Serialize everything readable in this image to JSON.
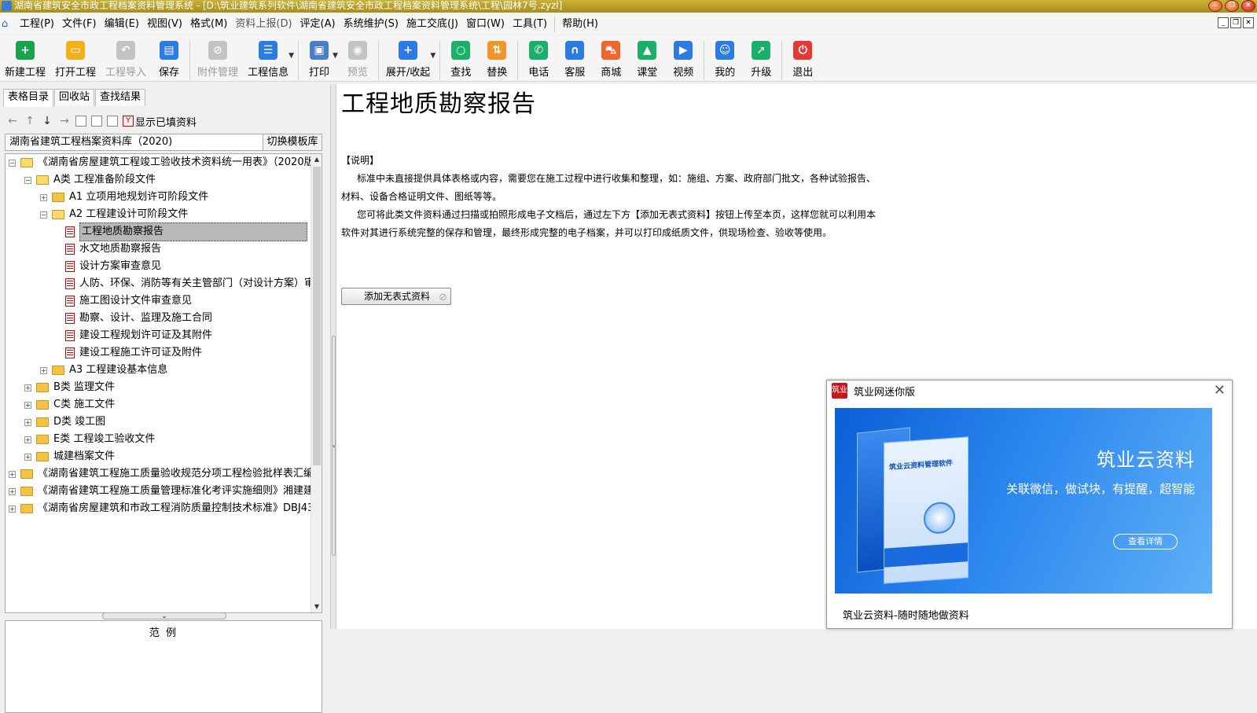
{
  "titlebar": {
    "title": "湖南省建筑安全市政工程档案资料管理系统 - [D:\\筑业建筑系列软件\\湖南省建筑安全市政工程档案资料管理系统\\工程\\园林7号.zyzl]"
  },
  "menu": [
    "工程(P)",
    "文件(F)",
    "编辑(E)",
    "视图(V)",
    "格式(M)",
    "资料上报(D)",
    "评定(A)",
    "系统维护(S)",
    "施工交底(J)",
    "窗口(W)",
    "工具(T)",
    "帮助(H)"
  ],
  "toolbar": [
    {
      "label": "新建工程",
      "icon": "new-project-icon",
      "color": "#1aa34a"
    },
    {
      "label": "打开工程",
      "icon": "open-folder-icon",
      "color": "#f2b11c"
    },
    {
      "label": "工程导入",
      "icon": "import-icon",
      "color": "#888888"
    },
    {
      "label": "保存",
      "icon": "save-icon",
      "color": "#2a7be4"
    },
    {
      "label": "附件管理",
      "icon": "attachment-icon",
      "color": "#888888"
    },
    {
      "label": "工程信息",
      "icon": "info-icon",
      "color": "#2a7be4"
    },
    {
      "label": "打印",
      "icon": "print-icon",
      "color": "#4a7ec8"
    },
    {
      "label": "预览",
      "icon": "preview-icon",
      "color": "#888888"
    },
    {
      "label": "展开/收起",
      "icon": "expand-icon",
      "color": "#2a7be4"
    },
    {
      "label": "查找",
      "icon": "search-icon",
      "color": "#1ab06a"
    },
    {
      "label": "替换",
      "icon": "replace-icon",
      "color": "#f0962a"
    },
    {
      "label": "电话",
      "icon": "phone-icon",
      "color": "#1ab06a"
    },
    {
      "label": "客服",
      "icon": "headset-icon",
      "color": "#2a7be4"
    },
    {
      "label": "商城",
      "icon": "cart-icon",
      "color": "#f0662a"
    },
    {
      "label": "课堂",
      "icon": "graduation-icon",
      "color": "#1ab06a"
    },
    {
      "label": "视频",
      "icon": "video-icon",
      "color": "#2a7be4"
    },
    {
      "label": "我的",
      "icon": "user-icon",
      "color": "#2a7be4"
    },
    {
      "label": "升级",
      "icon": "rocket-icon",
      "color": "#1ab06a"
    },
    {
      "label": "退出",
      "icon": "power-icon",
      "color": "#e53935"
    }
  ],
  "left": {
    "tabs": [
      "表格目录",
      "回收站",
      "查找结果"
    ],
    "show_filled": "显示已填资料",
    "library": "湖南省建筑工程档案资料库（2020)",
    "switch_template": "切换模板库",
    "tree": [
      "《湖南省房屋建筑工程竣工验收技术资料统一用表》（2020版",
      "A类 工程准备阶段文件",
      "A1 立项用地规划许可阶段文件",
      "A2 工程建设计可阶段文件",
      "工程地质勘察报告",
      "水文地质勘察报告",
      "设计方案审查意见",
      "人防、环保、消防等有关主管部门（对设计方案）审",
      "施工图设计文件审查意见",
      "勘察、设计、监理及施工合同",
      "建设工程规划许可证及其附件",
      "建设工程施工许可证及附件",
      "A3 工程建设基本信息",
      "B类 监理文件",
      "C类 施工文件",
      "D类 竣工图",
      "E类 工程竣工验收文件",
      "城建档案文件",
      "《湖南省建筑工程施工质量验收规范分项工程检验批样表汇编",
      "《湖南省建筑工程施工质量管理标准化考评实施细则》湘建建",
      "《湖南省房屋建筑和市政工程消防质量控制技术标准》DBJ43"
    ],
    "sample_title": "范 例"
  },
  "content": {
    "title": "工程地质勘察报告",
    "note_head": "【说明】",
    "p1": "标准中未直接提供具体表格或内容，需要您在施工过程中进行收集和整理，如：施组、方案、政府部门批文，各种试验报告、材料、设备合格证明文件、图纸等等。",
    "p2": "您可将此类文件资料通过扫描或拍照形成电子文档后，通过左下方【添加无表式资料】按钮上传至本页，这样您就可以利用本软件对其进行系统完整的保存和管理，最终形成完整的电子档案，并可以打印成纸质文件，供现场检查、验收等使用。",
    "add_button": "添加无表式资料"
  },
  "popup": {
    "logo": "筑业",
    "title": "筑业网迷你版",
    "banner_title": "筑业云资料",
    "banner_sub": "关联微信，做试块，有提醒，超智能",
    "banner_btn": "查看详情",
    "box_text": "筑业云资料管理软件",
    "footer": "筑业云资料-随时随地做资料"
  }
}
